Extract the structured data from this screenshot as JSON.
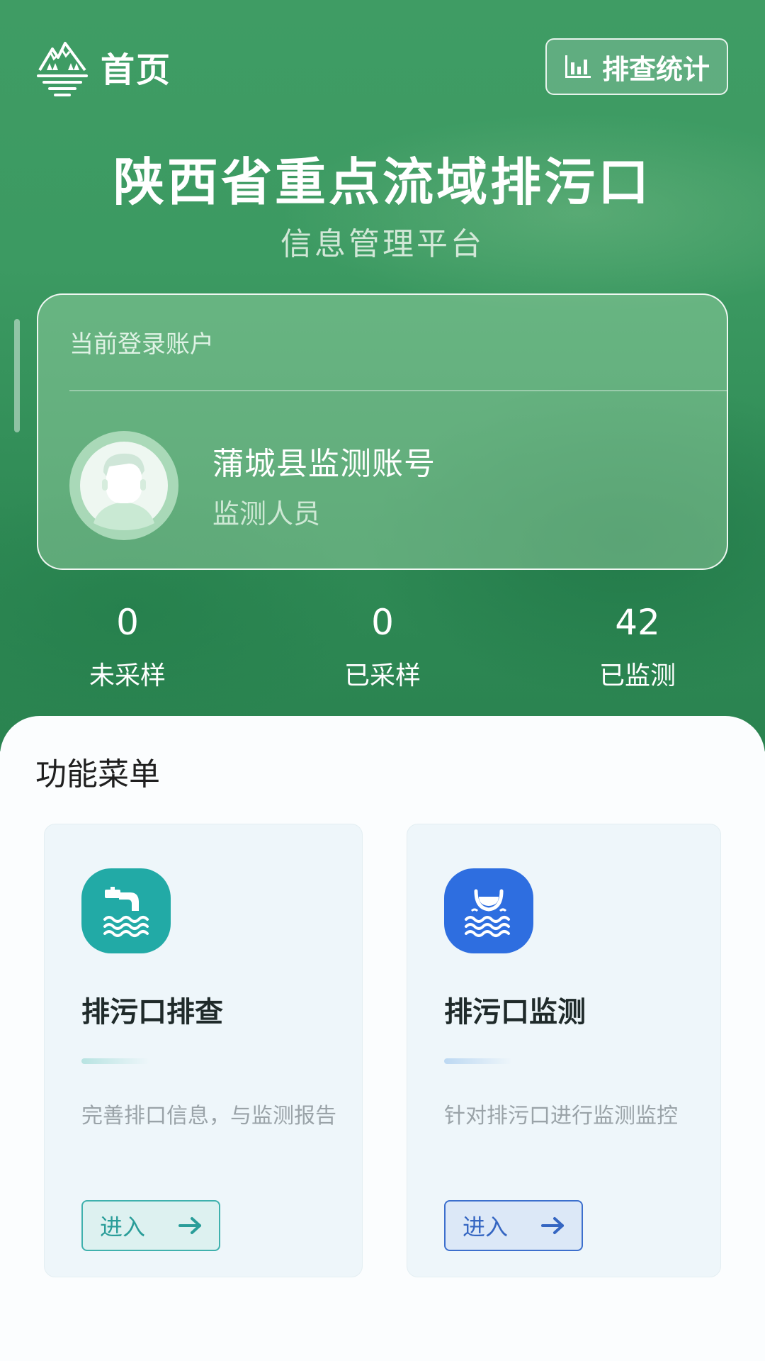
{
  "header": {
    "title": "首页",
    "stats_button": "排查统计",
    "logo_icon": "mountain-water-logo-icon",
    "stats_icon": "bar-chart-icon"
  },
  "hero": {
    "title": "陕西省重点流域排污口",
    "subtitle": "信息管理平台"
  },
  "account": {
    "label": "当前登录账户",
    "name": "蒲城县监测账号",
    "role": "监测人员",
    "avatar_icon": "user-avatar-icon"
  },
  "counts": [
    {
      "value": "0",
      "label": "未采样"
    },
    {
      "value": "0",
      "label": "已采样"
    },
    {
      "value": "42",
      "label": "已监测"
    }
  ],
  "menu": {
    "title": "功能菜单",
    "items": [
      {
        "name": "排污口排查",
        "description": "完善排口信息，与监测报告",
        "button": "进入",
        "icon": "outfall-pipe-icon",
        "accent": "#22aaa6"
      },
      {
        "name": "排污口监测",
        "description": "针对排污口进行监测监控",
        "button": "进入",
        "icon": "water-sampling-icon",
        "accent": "#2e6ee0"
      }
    ]
  },
  "colors": {
    "hero_green": "#3c9a62",
    "teal": "#22aaa6",
    "blue": "#2e6ee0"
  }
}
